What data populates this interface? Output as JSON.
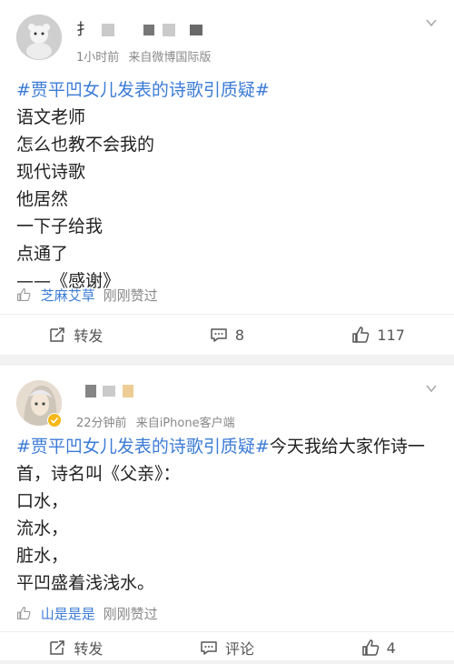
{
  "posts": [
    {
      "user_name": "扌",
      "time": "1小时前",
      "source": "来自微博国际版",
      "hashtag": "#贾平凹女儿发表的诗歌引质疑#",
      "lines": [
        "语文老师",
        "怎么也教不会我的",
        "现代诗歌",
        "他居然",
        "一下子给我",
        "点通了",
        "——《感谢》"
      ],
      "liker": "芝麻艾草",
      "liked_text": "刚刚赞过",
      "repost_label": "转发",
      "comment_count": "8",
      "like_count": "117"
    },
    {
      "time": "22分钟前",
      "source": "来自iPhone客户端",
      "hashtag": "#贾平凹女儿发表的诗歌引质疑#",
      "first_line_rest": "今天我给大家作诗一",
      "lines": [
        "首，诗名叫《父亲》：",
        "口水，",
        "流水，",
        "脏水，",
        "平凹盛着浅浅水。"
      ],
      "liker": "山是是是",
      "liked_text": "刚刚赞过",
      "repost_label": "转发",
      "comment_label": "评论",
      "like_count": "4"
    }
  ]
}
